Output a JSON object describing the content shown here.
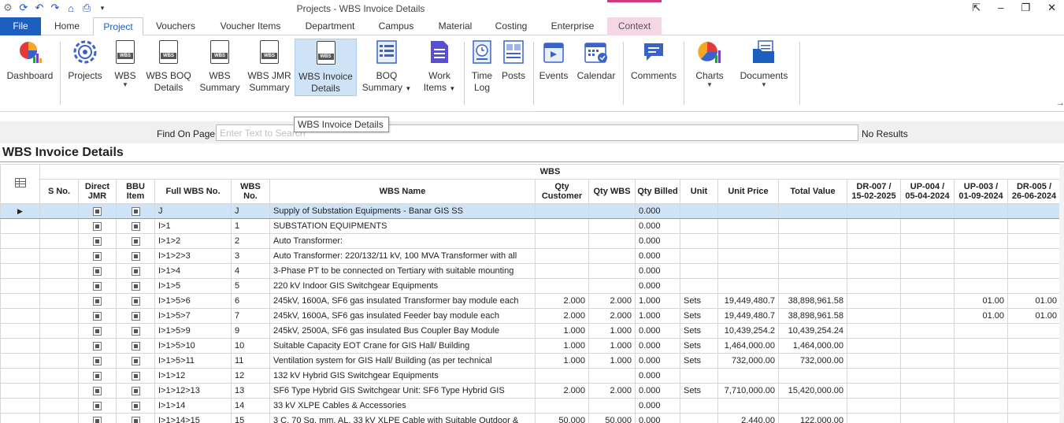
{
  "window": {
    "title": "Projects - WBS Invoice Details"
  },
  "tabs": [
    {
      "label": "File"
    },
    {
      "label": "Home"
    },
    {
      "label": "Project"
    },
    {
      "label": "Vouchers"
    },
    {
      "label": "Voucher Items"
    },
    {
      "label": "Department"
    },
    {
      "label": "Campus"
    },
    {
      "label": "Material"
    },
    {
      "label": "Costing"
    },
    {
      "label": "Enterprise"
    },
    {
      "label": "Context"
    }
  ],
  "ribbon": {
    "dashboard": "Dashboard",
    "projects": "Projects",
    "wbs": "WBS",
    "wbs_boq_1": "WBS BOQ",
    "wbs_boq_2": "Details",
    "wbs_summary_1": "WBS",
    "wbs_summary_2": "Summary",
    "wbs_jmr_1": "WBS JMR",
    "wbs_jmr_2": "Summary",
    "wbs_invoice_1": "WBS Invoice",
    "wbs_invoice_2": "Details",
    "boq_summary_1": "BOQ",
    "boq_summary_2": "Summary",
    "work_items_1": "Work",
    "work_items_2": "Items",
    "time_log_1": "Time",
    "time_log_2": "Log",
    "posts": "Posts",
    "events": "Events",
    "calendar": "Calendar",
    "comments": "Comments",
    "charts": "Charts",
    "documents": "Documents",
    "doc_badge": "WBS"
  },
  "tooltip": "WBS Invoice Details",
  "find": {
    "label": "Find On Page",
    "placeholder": "Enter Text to Search",
    "result": "No Results"
  },
  "page_title": "WBS Invoice Details",
  "grid": {
    "group_header": "WBS",
    "columns": {
      "sno": "S No.",
      "direct_jmr_1": "Direct",
      "direct_jmr_2": "JMR",
      "bbu_1": "BBU",
      "bbu_2": "Item",
      "full_wbs": "Full WBS No.",
      "wbs_no_1": "WBS",
      "wbs_no_2": "No.",
      "wbs_name": "WBS Name",
      "qty_cust_1": "Qty",
      "qty_cust_2": "Customer",
      "qty_wbs": "Qty WBS",
      "qty_billed": "Qty Billed",
      "unit": "Unit",
      "unit_price": "Unit Price",
      "total_value": "Total Value",
      "dr007_1": "DR-007 /",
      "dr007_2": "15-02-2025",
      "up004_1": "UP-004 /",
      "up004_2": "05-04-2024",
      "up003_1": "UP-003 /",
      "up003_2": "01-09-2024",
      "dr005_1": "DR-005 /",
      "dr005_2": "26-06-2024"
    },
    "rows": [
      {
        "full": "J",
        "no": "J",
        "name": "Supply of Substation Equipments - Banar GIS SS",
        "qc": "",
        "qw": "",
        "qb": "0.000",
        "unit": "",
        "price": "",
        "total": "",
        "dr007": "",
        "up004": "",
        "up003": "",
        "dr005": ""
      },
      {
        "full": "I>1",
        "no": "1",
        "name": "SUBSTATION EQUIPMENTS",
        "qc": "",
        "qw": "",
        "qb": "0.000",
        "unit": "",
        "price": "",
        "total": "",
        "dr007": "",
        "up004": "",
        "up003": "",
        "dr005": ""
      },
      {
        "full": "I>1>2",
        "no": "2",
        "name": "Auto Transformer:",
        "qc": "",
        "qw": "",
        "qb": "0.000",
        "unit": "",
        "price": "",
        "total": "",
        "dr007": "",
        "up004": "",
        "up003": "",
        "dr005": ""
      },
      {
        "full": "I>1>2>3",
        "no": "3",
        "name": "Auto Transformer: 220/132/11 kV, 100 MVA Transformer with all",
        "qc": "",
        "qw": "",
        "qb": "0.000",
        "unit": "",
        "price": "",
        "total": "",
        "dr007": "",
        "up004": "",
        "up003": "",
        "dr005": ""
      },
      {
        "full": "I>1>4",
        "no": "4",
        "name": "3-Phase PT to be connected on Tertiary with suitable mounting",
        "qc": "",
        "qw": "",
        "qb": "0.000",
        "unit": "",
        "price": "",
        "total": "",
        "dr007": "",
        "up004": "",
        "up003": "",
        "dr005": ""
      },
      {
        "full": "I>1>5",
        "no": "5",
        "name": "220 kV Indoor GIS Switchgear Equipments",
        "qc": "",
        "qw": "",
        "qb": "0.000",
        "unit": "",
        "price": "",
        "total": "",
        "dr007": "",
        "up004": "",
        "up003": "",
        "dr005": ""
      },
      {
        "full": "I>1>5>6",
        "no": "6",
        "name": "245kV, 1600A, SF6 gas insulated Transformer bay module each",
        "qc": "2.000",
        "qw": "2.000",
        "qb": "1.000",
        "unit": "Sets",
        "price": "19,449,480.7",
        "total": "38,898,961.58",
        "dr007": "",
        "up004": "",
        "up003": "01.00",
        "dr005": "01.00"
      },
      {
        "full": "I>1>5>7",
        "no": "7",
        "name": "245kV, 1600A, SF6 gas insulated Feeder bay module each",
        "qc": "2.000",
        "qw": "2.000",
        "qb": "1.000",
        "unit": "Sets",
        "price": "19,449,480.7",
        "total": "38,898,961.58",
        "dr007": "",
        "up004": "",
        "up003": "01.00",
        "dr005": "01.00"
      },
      {
        "full": "I>1>5>9",
        "no": "9",
        "name": "245kV, 2500A, SF6 gas insulated Bus Coupler Bay Module",
        "qc": "1.000",
        "qw": "1.000",
        "qb": "0.000",
        "unit": "Sets",
        "price": "10,439,254.2",
        "total": "10,439,254.24",
        "dr007": "",
        "up004": "",
        "up003": "",
        "dr005": ""
      },
      {
        "full": "I>1>5>10",
        "no": "10",
        "name": "Suitable Capacity EOT Crane for GIS Hall/ Building",
        "qc": "1.000",
        "qw": "1.000",
        "qb": "0.000",
        "unit": "Sets",
        "price": "1,464,000.00",
        "total": "1,464,000.00",
        "dr007": "",
        "up004": "",
        "up003": "",
        "dr005": ""
      },
      {
        "full": "I>1>5>11",
        "no": "11",
        "name": "Ventilation system for GIS Hall/ Building (as per technical",
        "qc": "1.000",
        "qw": "1.000",
        "qb": "0.000",
        "unit": "Sets",
        "price": "732,000.00",
        "total": "732,000.00",
        "dr007": "",
        "up004": "",
        "up003": "",
        "dr005": ""
      },
      {
        "full": "I>1>12",
        "no": "12",
        "name": "132 kV Hybrid GIS Switchgear Equipments",
        "qc": "",
        "qw": "",
        "qb": "0.000",
        "unit": "",
        "price": "",
        "total": "",
        "dr007": "",
        "up004": "",
        "up003": "",
        "dr005": ""
      },
      {
        "full": "I>1>12>13",
        "no": "13",
        "name": "SF6 Type Hybrid GIS Switchgear Unit: SF6 Type Hybrid GIS",
        "qc": "2.000",
        "qw": "2.000",
        "qb": "0.000",
        "unit": "Sets",
        "price": "7,710,000.00",
        "total": "15,420,000.00",
        "dr007": "",
        "up004": "",
        "up003": "",
        "dr005": ""
      },
      {
        "full": "I>1>14",
        "no": "14",
        "name": "33 kV XLPE Cables & Accessories",
        "qc": "",
        "qw": "",
        "qb": "0.000",
        "unit": "",
        "price": "",
        "total": "",
        "dr007": "",
        "up004": "",
        "up003": "",
        "dr005": ""
      },
      {
        "full": "I>1>14>15",
        "no": "15",
        "name": "3 C, 70 Sq. mm, AL, 33 kV XLPE Cable with Suitable Outdoor &",
        "qc": "50.000",
        "qw": "50.000",
        "qb": "0.000",
        "unit": "",
        "price": "2,440.00",
        "total": "122,000.00",
        "dr007": "",
        "up004": "",
        "up003": "",
        "dr005": ""
      }
    ]
  }
}
